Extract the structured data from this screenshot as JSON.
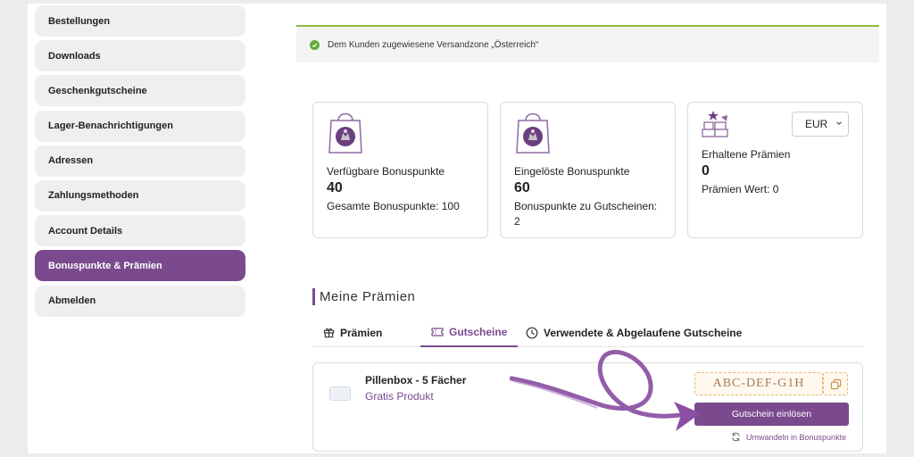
{
  "sidebar": {
    "items": [
      {
        "label": "Bestellungen"
      },
      {
        "label": "Downloads"
      },
      {
        "label": "Geschenkgutscheine"
      },
      {
        "label": "Lager-Benachrichtigungen"
      },
      {
        "label": "Adressen"
      },
      {
        "label": "Zahlungsmethoden"
      },
      {
        "label": "Account Details"
      },
      {
        "label": "Bonuspunkte & Prämien"
      },
      {
        "label": "Abmelden"
      }
    ],
    "active_index": 7
  },
  "notice": {
    "text": "Dem Kunden zugewiesene Versandzone „Österreich“"
  },
  "cards": {
    "available": {
      "label": "Verfügbare Bonuspunkte",
      "value": "40",
      "sub": "Gesamte Bonuspunkte: 100"
    },
    "redeemed": {
      "label": "Eingelöste Bonuspunkte",
      "value": "60",
      "sub": "Bonuspunkte zu Gutscheinen: 2"
    },
    "rewards": {
      "label": "Erhaltene Prämien",
      "value": "0",
      "sub": "Prämien Wert: 0",
      "currency": "EUR"
    }
  },
  "section": {
    "title": "Meine Prämien"
  },
  "tabs": [
    {
      "label": "Prämien"
    },
    {
      "label": "Gutscheine"
    },
    {
      "label": "Verwendete & Abgelaufene Gutscheine"
    }
  ],
  "active_tab": 1,
  "coupon": {
    "product_name": "Pillenbox - 5 Fächer",
    "product_type": "Gratis Produkt",
    "code": "ABC-DEF-G1H",
    "redeem_label": "Gutschein einlösen",
    "convert_label": "Umwandeln in Bonuspunkte"
  },
  "colors": {
    "accent": "#7b4a8e",
    "success": "#5fae3a",
    "notice_border": "#8dbb3c",
    "code_border": "#e8b770"
  }
}
